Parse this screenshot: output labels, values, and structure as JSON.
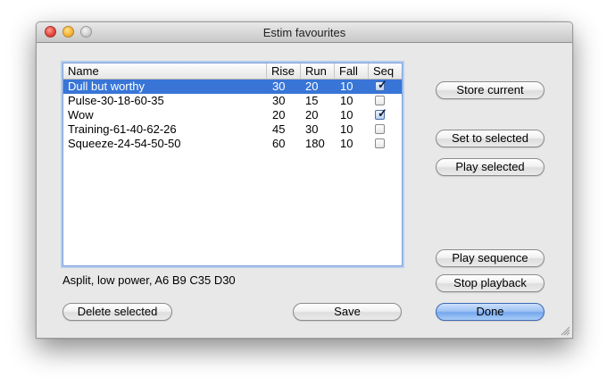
{
  "window": {
    "title": "Estim favourites"
  },
  "table": {
    "columns": [
      "Name",
      "Rise",
      "Run",
      "Fall",
      "Seq"
    ],
    "rows": [
      {
        "name": "Dull but worthy",
        "rise": "30",
        "run": "20",
        "fall": "10",
        "seq": true,
        "selected": true
      },
      {
        "name": "Pulse-30-18-60-35",
        "rise": "30",
        "run": "15",
        "fall": "10",
        "seq": false,
        "selected": false
      },
      {
        "name": "Wow",
        "rise": "20",
        "run": "20",
        "fall": "10",
        "seq": true,
        "selected": false
      },
      {
        "name": "Training-61-40-62-26",
        "rise": "45",
        "run": "30",
        "fall": "10",
        "seq": false,
        "selected": false
      },
      {
        "name": "Squeeze-24-54-50-50",
        "rise": "60",
        "run": "180",
        "fall": "10",
        "seq": false,
        "selected": false
      }
    ]
  },
  "status": {
    "text": "Asplit, low power, A6 B9 C35 D30"
  },
  "buttons": {
    "store_current": "Store current",
    "set_to_selected": "Set to selected",
    "play_selected": "Play selected",
    "play_sequence": "Play sequence",
    "stop_playback": "Stop playback",
    "delete_selected": "Delete selected",
    "save": "Save",
    "done": "Done"
  },
  "colors": {
    "selection": "#3875d7",
    "default_button": "#76a7ee",
    "close": "#e0443a",
    "minimize": "#f5b234"
  }
}
